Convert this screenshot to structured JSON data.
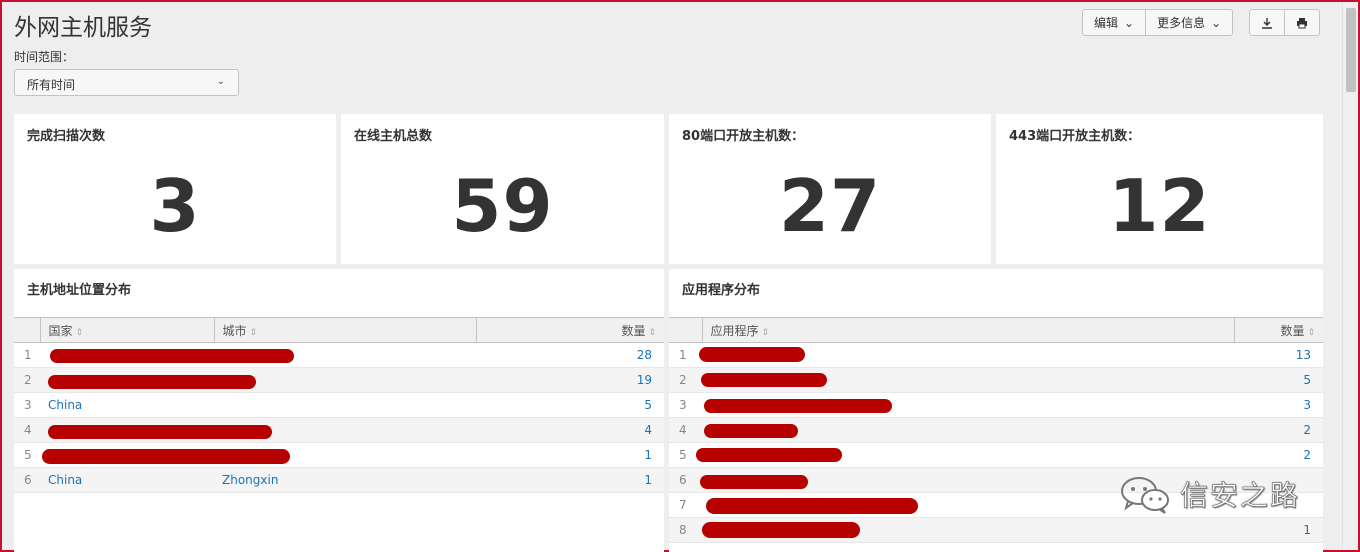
{
  "page": {
    "title": "外网主机服务"
  },
  "time_range": {
    "label": "时间范围：",
    "value": "所有时间"
  },
  "toolbar": {
    "edit_label": "编辑",
    "more_label": "更多信息"
  },
  "kpis": [
    {
      "title": "完成扫描次数",
      "value": "3"
    },
    {
      "title": "在线主机总数",
      "value": "59"
    },
    {
      "title": "80端口开放主机数：",
      "value": "27"
    },
    {
      "title": "443端口开放主机数：",
      "value": "12"
    }
  ],
  "geo_table": {
    "title": "主机地址位置分布",
    "columns": [
      "国家",
      "城市",
      "数量"
    ],
    "rows": [
      {
        "idx": "1",
        "country": "",
        "city": "",
        "count": "28"
      },
      {
        "idx": "2",
        "country": "",
        "city": "",
        "count": "19"
      },
      {
        "idx": "3",
        "country": "China",
        "city": "",
        "count": "5"
      },
      {
        "idx": "4",
        "country": "",
        "city": "",
        "count": "4"
      },
      {
        "idx": "5",
        "country": "",
        "city": "",
        "count": "1"
      },
      {
        "idx": "6",
        "country": "China",
        "city": "Zhongxin",
        "count": "1"
      }
    ]
  },
  "app_table": {
    "title": "应用程序分布",
    "columns": [
      "应用程序",
      "数量"
    ],
    "rows": [
      {
        "idx": "1",
        "app": "",
        "count": "13"
      },
      {
        "idx": "2",
        "app": "",
        "count": "5"
      },
      {
        "idx": "3",
        "app": "",
        "count": "3"
      },
      {
        "idx": "4",
        "app": "",
        "count": "2"
      },
      {
        "idx": "5",
        "app": "",
        "count": "2"
      },
      {
        "idx": "6",
        "app": "",
        "count": ""
      },
      {
        "idx": "7",
        "app": "",
        "count": ""
      },
      {
        "idx": "8",
        "app": "",
        "count": "1"
      }
    ]
  },
  "watermark": {
    "text": "信安之路",
    "icon": "wechat-icon"
  },
  "colors": {
    "link": "#1a73b8",
    "frame": "#c8102e",
    "redaction": "#b70000"
  }
}
